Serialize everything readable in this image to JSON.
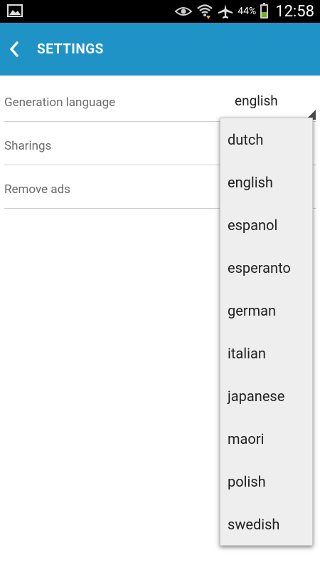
{
  "status_bar": {
    "battery_percent": "44%",
    "time": "12:58",
    "battery_level": 0.44,
    "icons": [
      "gallery-icon",
      "eye-icon",
      "wifi-icon",
      "airplane-mode-icon",
      "battery-icon"
    ]
  },
  "header": {
    "title": "SETTINGS",
    "back_icon": "chevron-left-icon",
    "color": "#1f93c6"
  },
  "settings": {
    "generation_language_label": "Generation language",
    "generation_language_value": "english",
    "sharings_label": "Sharings",
    "remove_ads_label": "Remove ads"
  },
  "dropdown": {
    "options": [
      "dutch",
      "english",
      "espanol",
      "esperanto",
      "german",
      "italian",
      "japanese",
      "maori",
      "polish",
      "swedish"
    ]
  }
}
